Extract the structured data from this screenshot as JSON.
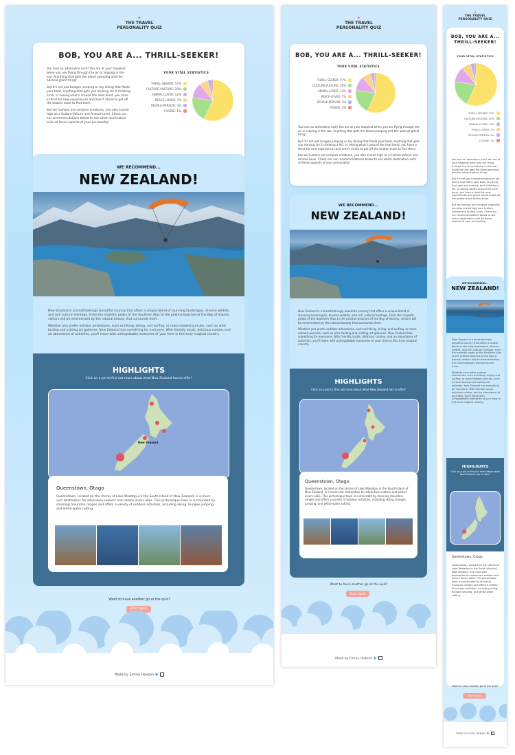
{
  "logo": {
    "line1": "THE TRAVEL",
    "line2": "PERSONALITY QUIZ",
    "plane": "✈"
  },
  "result": {
    "title": "BOB, YOU ARE A... THRILL-SEEKER!",
    "paragraphs": [
      "You love an adrenaline rush! You are at your happiest when you are flying through the air or leaping in the sea. Anything that gets the blood pumping and the adrenal gland firing!",
      "But it's not just bungee jumping or sky diving that floats your boat, anything that gets you moving, be it climbing a hill, or seeing what's around the next bend, you have a thirst for new experiences and aren't afraid to get off the beaten track to find them.",
      "But we humans are complex creatures, you also scored high as a Culture-Vulture and Animal-Lover. Check our our recommendations below to see which destination suits all these aspects of your personality!"
    ],
    "stats_title": "YOUR VITAL STATISTICS",
    "stats": [
      {
        "label": "THRILL-SEEKER: 57%",
        "value": 57,
        "color": "#fbe16a"
      },
      {
        "label": "CULTURE-VULTURE: 20%",
        "value": 20,
        "color": "#a4e08a"
      },
      {
        "label": "ANIMAL-LOVER: 12%",
        "value": 12,
        "color": "#e3a8ea"
      },
      {
        "label": "PEACE-LOVER: 7%",
        "value": 7,
        "color": "#fbd48a"
      },
      {
        "label": "PEOPLE-PERSON: 3%",
        "value": 3,
        "color": "#b9b0f2"
      },
      {
        "label": "FOODIE: 1%",
        "value": 1,
        "color": "#f08a8a"
      }
    ]
  },
  "recommend": {
    "subtitle": "WE RECOMMEND...",
    "title": "NEW ZEALAND!",
    "paragraphs": [
      "New Zealand is a breathtakingly beautiful country that offers a unique blend of stunning landscapes, diverse wildlife, and rich cultural heritage. From the majestic peaks of the Southern Alps to the pristine beaches of the Bay of Islands, visitors will be mesmerized by the natural beauty that surrounds them.",
      "Whether you prefer outdoor adventures, such as hiking, skiing, and surfing, or more relaxed pursuits, such as wine tasting and visiting art galleries, New Zealand has something for everyone. With friendly locals, delicious cuisine, and an abundance of activities, you'll leave with unforgettable memories of your time in this truly magical country."
    ]
  },
  "highlights": {
    "title": "HIGHLIGHTS",
    "subtitle": "Click on a pin to find out more about what New Zealand has to offer!",
    "map_label": "New Zealand",
    "location_title": "Queenstown, Otago",
    "location_text": "Queenstown, located on the shores of Lake Wakatipu in the South Island of New Zealand, is a must-visit destination for adventure seekers and nature lovers alike. This picturesque town is surrounded by stunning mountain ranges and offers a variety of outdoor activities, including skiing, bungee jumping, and white-water rafting."
  },
  "again": {
    "prompt": "Want to have another go at the quiz?",
    "button": "Start Again"
  },
  "footer": {
    "text": "Made by Emma Hewson",
    "twitter_icon": "twitter-icon",
    "instagram_icon": "instagram-icon"
  }
}
